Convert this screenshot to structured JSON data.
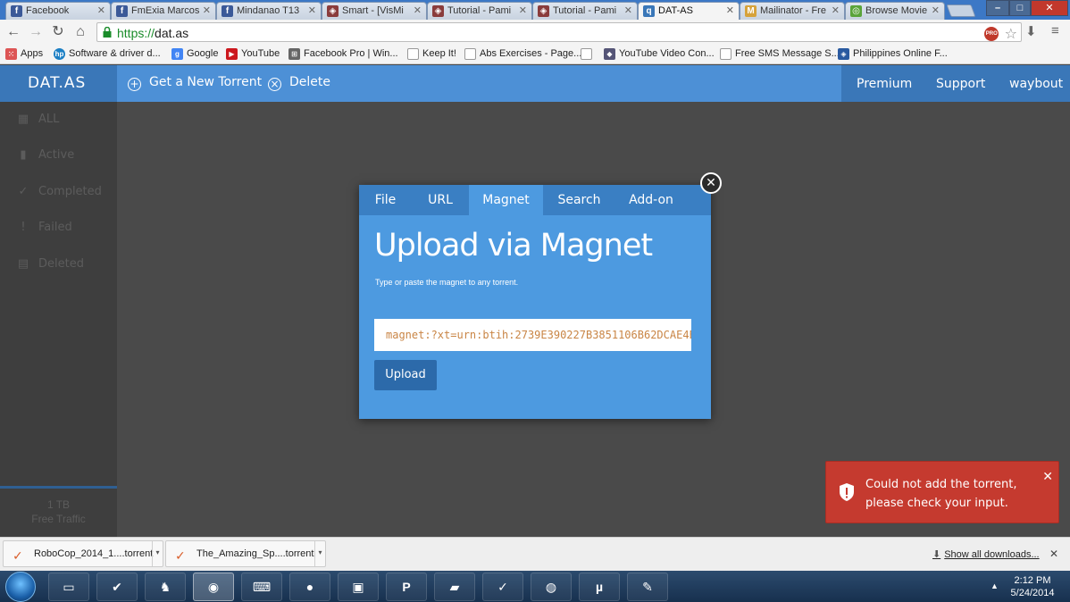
{
  "browser": {
    "tabs": [
      {
        "label": "Facebook",
        "icon": "facebook-icon",
        "active": false
      },
      {
        "label": "FmExia Marcos",
        "icon": "facebook-icon",
        "active": false
      },
      {
        "label": "Mindanao T13",
        "icon": "facebook-icon",
        "active": false
      },
      {
        "label": "Smart - [VisMi",
        "icon": "smart-icon",
        "active": false
      },
      {
        "label": "Tutorial - Pami",
        "icon": "tutorial-icon",
        "active": false
      },
      {
        "label": "Tutorial - Pami",
        "icon": "tutorial-icon",
        "active": false
      },
      {
        "label": "DAT-AS",
        "icon": "datas-icon",
        "active": true
      },
      {
        "label": "Mailinator - Fre",
        "icon": "mailinator-icon",
        "active": false
      },
      {
        "label": "Browse Movie",
        "icon": "browse-movie-icon",
        "active": false
      }
    ],
    "url_scheme": "https://",
    "url_host": "dat.as",
    "pro_badge": "PRO",
    "bookmarks": [
      {
        "label": "Apps"
      },
      {
        "label": "Software & driver d..."
      },
      {
        "label": "Google"
      },
      {
        "label": "YouTube"
      },
      {
        "label": "Facebook Pro | Win..."
      },
      {
        "label": "Keep It!"
      },
      {
        "label": "Abs Exercises - Page..."
      },
      {
        "label": ""
      },
      {
        "label": "YouTube Video Con..."
      },
      {
        "label": "Free SMS Message S..."
      },
      {
        "label": "Philippines Online F..."
      }
    ]
  },
  "site": {
    "logo": "DAT.AS",
    "actions": {
      "new_torrent": "Get a New Torrent",
      "delete": "Delete"
    },
    "nav": {
      "premium": "Premium",
      "support": "Support",
      "user": "waybout"
    },
    "sidebar": [
      {
        "label": "ALL",
        "icon": "grid-icon"
      },
      {
        "label": "Active",
        "icon": "bar-chart-icon"
      },
      {
        "label": "Completed",
        "icon": "check-circle-icon"
      },
      {
        "label": "Failed",
        "icon": "exclamation-circle-icon"
      },
      {
        "label": "Deleted",
        "icon": "trash-icon"
      }
    ],
    "traffic": {
      "amount": "1 TB",
      "label": "Free Traffic"
    }
  },
  "modal": {
    "tabs": [
      {
        "label": "File"
      },
      {
        "label": "URL"
      },
      {
        "label": "Magnet"
      },
      {
        "label": "Search"
      },
      {
        "label": "Add-on"
      }
    ],
    "active_tab": "Magnet",
    "title": "Upload via Magnet",
    "subtitle": "Type or paste the magnet to any torrent.",
    "input_value": "magnet:?xt=urn:btih:2739E390227B3851106B62DCAE4E",
    "upload_label": "Upload",
    "close_glyph": "✕"
  },
  "toast": {
    "message": "Could not add the torrent, please check your input.",
    "close_glyph": "✕",
    "color": "#c53a2f"
  },
  "downloads": {
    "items": [
      {
        "label": "RoboCop_2014_1....torrent"
      },
      {
        "label": "The_Amazing_Sp....torrent"
      }
    ],
    "show_all": "Show all downloads...",
    "close_glyph": "✕"
  },
  "taskbar": {
    "time": "2:12 PM",
    "date": "5/24/2014"
  },
  "colors": {
    "accent": "#4d90d6",
    "accent_dark": "#3a77b8",
    "modal": "#4d9ae0",
    "error": "#c53a2f",
    "input_text": "#c98545"
  }
}
